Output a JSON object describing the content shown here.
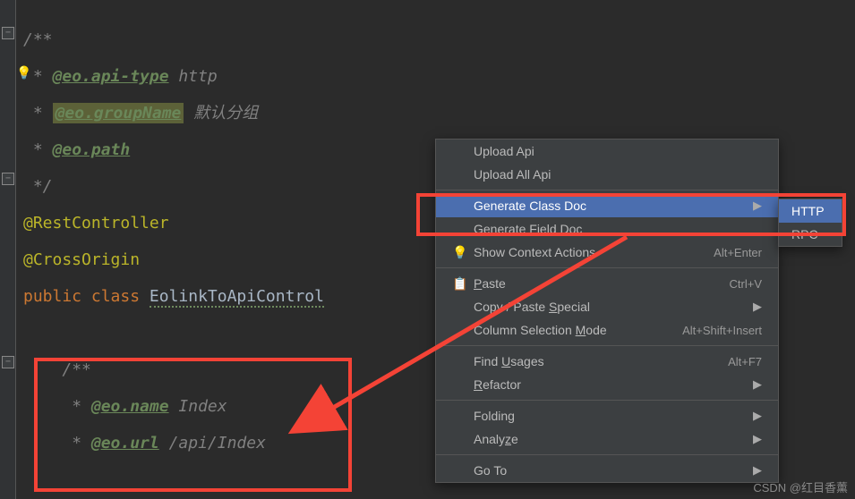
{
  "code": {
    "comment_open": "/**",
    "l1_star": " * ",
    "l1_tag": "@eo.api-type",
    "l1_val": " http",
    "l2_star": " * ",
    "l2_tag": "@eo.groupName",
    "l2_val": " 默认分组",
    "l3_star": " * ",
    "l3_tag": "@eo.path",
    "comment_close": " */",
    "anno1": "@RestController",
    "anno2": "@CrossOrigin",
    "kw_public": "public ",
    "kw_class": "class ",
    "classname": "EolinkToApiControl",
    "inner_open": "/**",
    "i1_star": " * ",
    "i1_tag": "@eo.name",
    "i1_val": " Index",
    "i2_star": " * ",
    "i2_tag": "@eo.url",
    "i2_val": " /api/Index"
  },
  "menu": {
    "upload_api": "Upload Api",
    "upload_all": "Upload All Api",
    "gen_class": "Generate Class Doc",
    "gen_field": "Generate Field Doc",
    "context_actions": "Show Context Actions",
    "context_shortcut": "Alt+Enter",
    "paste": "Paste",
    "paste_k": "P",
    "paste_shortcut": "Ctrl+V",
    "copy_special": "Copy / Paste Special",
    "copy_special_k": "S",
    "col_mode": "Column Selection Mode",
    "col_mode_k": "M",
    "col_mode_shortcut": "Alt+Shift+Insert",
    "find_usages": "Find Usages",
    "find_usages_k": "U",
    "find_usages_shortcut": "Alt+F7",
    "refactor": "Refactor",
    "refactor_k": "R",
    "folding": "Folding",
    "analyze": "Analyze",
    "analyze_k": "z",
    "goto": "Go To"
  },
  "submenu": {
    "http": "HTTP",
    "rpc": "RPC"
  },
  "watermark": "CSDN @红目香薰"
}
